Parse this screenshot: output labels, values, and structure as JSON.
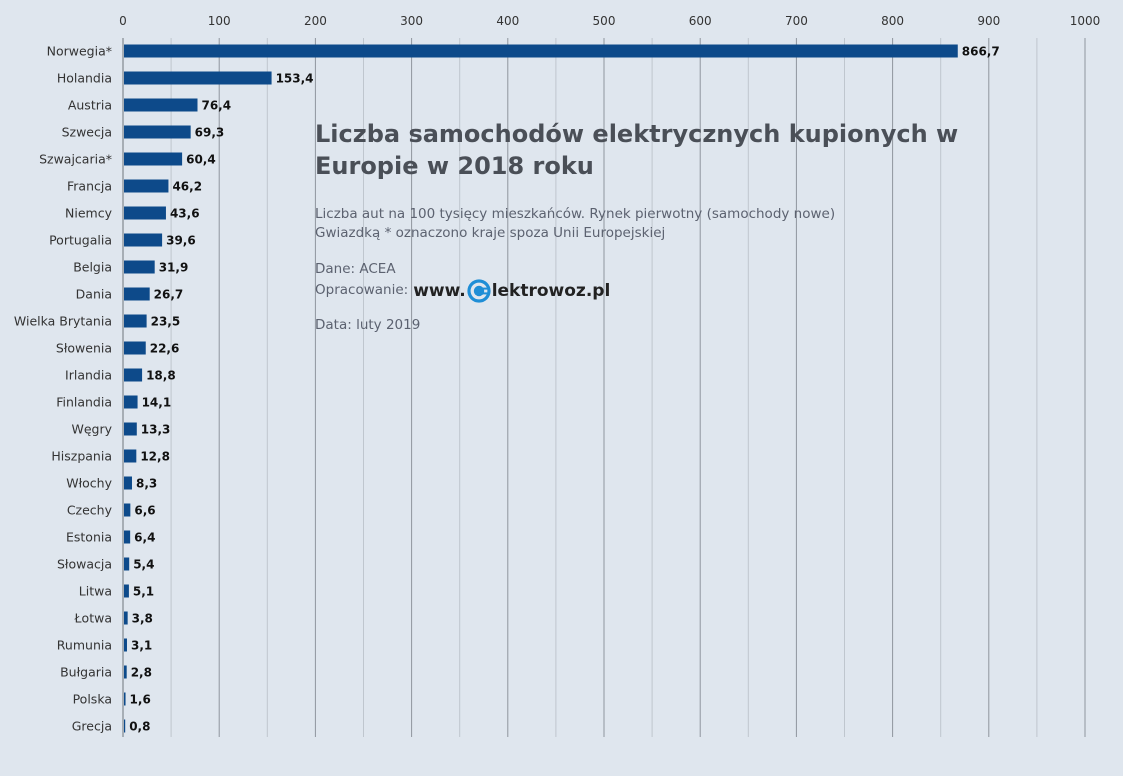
{
  "chart_data": {
    "type": "bar",
    "orientation": "horizontal",
    "title": "Liczba samochodów elektrycznych kupionych w Europie w 2018 roku",
    "subtitle_lines": [
      "Liczba aut na 100 tysięcy mieszkańców. Rynek pierwotny (samochody nowe)",
      "Gwiazdką * oznaczono kraje spoza Unii Europejskiej"
    ],
    "source": "Dane: ACEA",
    "credit_prefix": "Opracowanie:",
    "credit_brand_www": "www.",
    "credit_brand_rest": "lektrowoz.pl",
    "date": "Data: luty 2019",
    "xlim": [
      0,
      1000
    ],
    "xticks": [
      0,
      100,
      200,
      300,
      400,
      500,
      600,
      700,
      800,
      900,
      1000
    ],
    "grid": true,
    "bar_color": "#0d4a8a",
    "categories": [
      "Norwegia*",
      "Holandia",
      "Austria",
      "Szwecja",
      "Szwajcaria*",
      "Francja",
      "Niemcy",
      "Portugalia",
      "Belgia",
      "Dania",
      "Wielka Brytania",
      "Słowenia",
      "Irlandia",
      "Finlandia",
      "Węgry",
      "Hiszpania",
      "Włochy",
      "Czechy",
      "Estonia",
      "Słowacja",
      "Litwa",
      "Łotwa",
      "Rumunia",
      "Bułgaria",
      "Polska",
      "Grecja"
    ],
    "values": [
      866.7,
      153.4,
      76.4,
      69.3,
      60.4,
      46.2,
      43.6,
      39.6,
      31.9,
      26.7,
      23.5,
      22.6,
      18.8,
      14.1,
      13.3,
      12.8,
      8.3,
      6.6,
      6.4,
      5.4,
      5.1,
      3.8,
      3.1,
      2.8,
      1.6,
      0.8
    ],
    "value_labels": [
      "866,7",
      "153,4",
      "76,4",
      "69,3",
      "60,4",
      "46,2",
      "43,6",
      "39,6",
      "31,9",
      "26,7",
      "23,5",
      "22,6",
      "18,8",
      "14,1",
      "13,3",
      "12,8",
      "8,3",
      "6,6",
      "6,4",
      "5,4",
      "5,1",
      "3,8",
      "3,1",
      "2,8",
      "1,6",
      "0,8"
    ]
  }
}
